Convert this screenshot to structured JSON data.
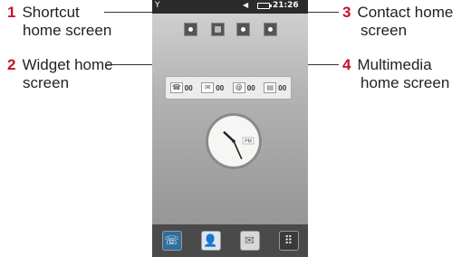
{
  "callouts": [
    {
      "num": "1",
      "line1": "Shortcut",
      "line2": "home screen"
    },
    {
      "num": "2",
      "line1": "Widget home",
      "line2": "screen"
    },
    {
      "num": "3",
      "line1": "Contact home",
      "line2": "screen"
    },
    {
      "num": "4",
      "line1": "Multimedia",
      "line2": "home screen"
    }
  ],
  "status_bar": {
    "time": "21:26",
    "signal_icon": "signal-antenna-icon",
    "sound_icon": "speaker-icon",
    "battery_icon": "battery-icon"
  },
  "page_indicators": [
    "shortcut",
    "widget",
    "contact",
    "multimedia"
  ],
  "widget_bar": [
    {
      "icon": "phone-icon",
      "count": "00"
    },
    {
      "icon": "envelope-icon",
      "count": "00"
    },
    {
      "icon": "voicemail-icon",
      "count": "00"
    },
    {
      "icon": "message-icon",
      "count": "00"
    }
  ],
  "clock": {
    "label": "PM",
    "hour": 10,
    "minute": 26
  },
  "dock": [
    {
      "icon": "dialer-icon"
    },
    {
      "icon": "contacts-icon"
    },
    {
      "icon": "messaging-icon"
    },
    {
      "icon": "menu-grid-icon"
    }
  ]
}
